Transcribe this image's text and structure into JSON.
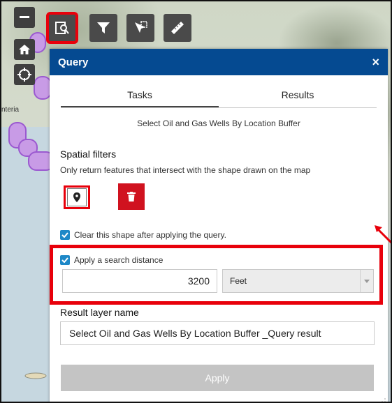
{
  "map": {
    "coast_label": "nteria"
  },
  "toolbar": {
    "tools": [
      "query-tool",
      "filter-tool",
      "select-tool",
      "measure-tool"
    ]
  },
  "panel": {
    "title": "Query",
    "close_label": "×",
    "tabs": [
      {
        "label": "Tasks",
        "active": true
      },
      {
        "label": "Results",
        "active": false
      }
    ],
    "task_name": "Select Oil and Gas Wells By Location Buffer",
    "spatial": {
      "title": "Spatial filters",
      "description": "Only return features that intersect with the shape drawn on the map"
    },
    "clear_shape": {
      "label": "Clear this shape after applying the query.",
      "checked": true
    },
    "search_distance": {
      "label": "Apply a search distance",
      "checked": true,
      "value": "3200",
      "unit": "Feet"
    },
    "result_layer": {
      "title": "Result layer name",
      "value": "Select Oil and Gas Wells By Location Buffer _Query result"
    },
    "apply_label": "Apply"
  },
  "colors": {
    "header": "#054a91",
    "highlight": "#e8000b",
    "trash": "#d0121f",
    "checkbox": "#1e88c7"
  }
}
